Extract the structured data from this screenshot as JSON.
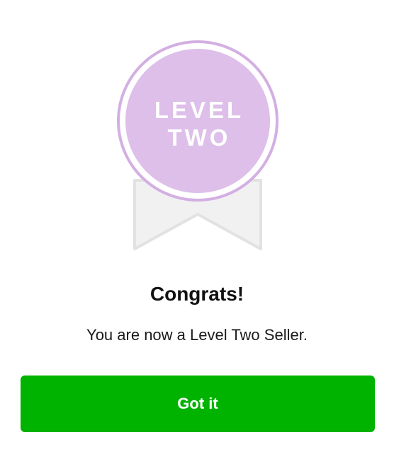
{
  "badge": {
    "line1": "LEVEL",
    "line2": "TWO",
    "icon": "level-two-ribbon-icon",
    "fill_color": "#ddbfe9",
    "ring_color": "#d3afe3",
    "ribbon_color": "#f1f1f1",
    "ribbon_border": "#e2e2e2"
  },
  "dialog": {
    "title": "Congrats!",
    "message": "You are now a Level Two Seller."
  },
  "actions": {
    "confirm_label": "Got it",
    "confirm_color": "#00b300"
  }
}
